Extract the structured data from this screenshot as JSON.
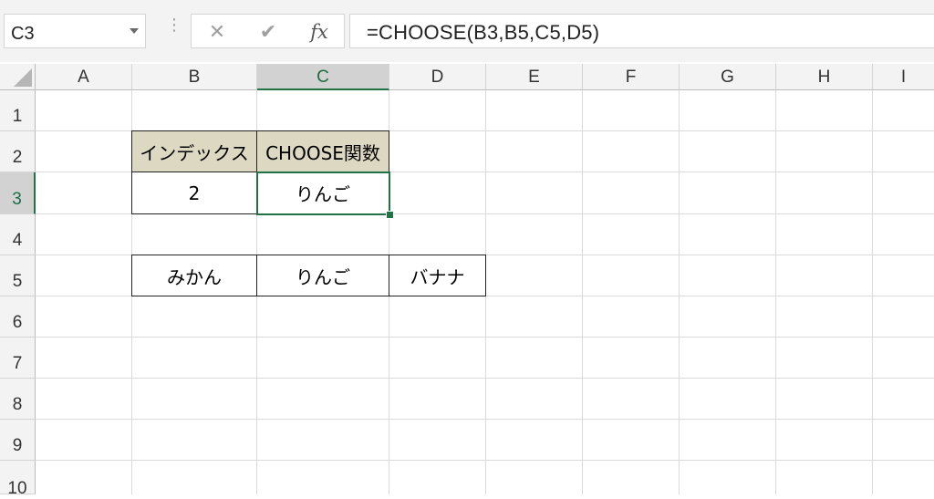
{
  "formula_bar": {
    "name_box": "C3",
    "cancel_glyph": "✕",
    "enter_glyph": "✔",
    "fx_glyph": "fx",
    "formula": "=CHOOSE(B3,B5,C5,D5)"
  },
  "columns": [
    "A",
    "B",
    "C",
    "D",
    "E",
    "F",
    "G",
    "H",
    "I"
  ],
  "rows": [
    "1",
    "2",
    "3",
    "4",
    "5",
    "6",
    "7",
    "8",
    "9",
    "10"
  ],
  "active_cell": "C3",
  "cells": {
    "B2": "インデックス",
    "C2": "CHOOSE関数",
    "B3": "2",
    "C3": "りんご",
    "B5": "みかん",
    "C5": "りんご",
    "D5": "バナナ"
  },
  "colors": {
    "header_fill": "#ddd8c1",
    "active_border": "#217346"
  }
}
